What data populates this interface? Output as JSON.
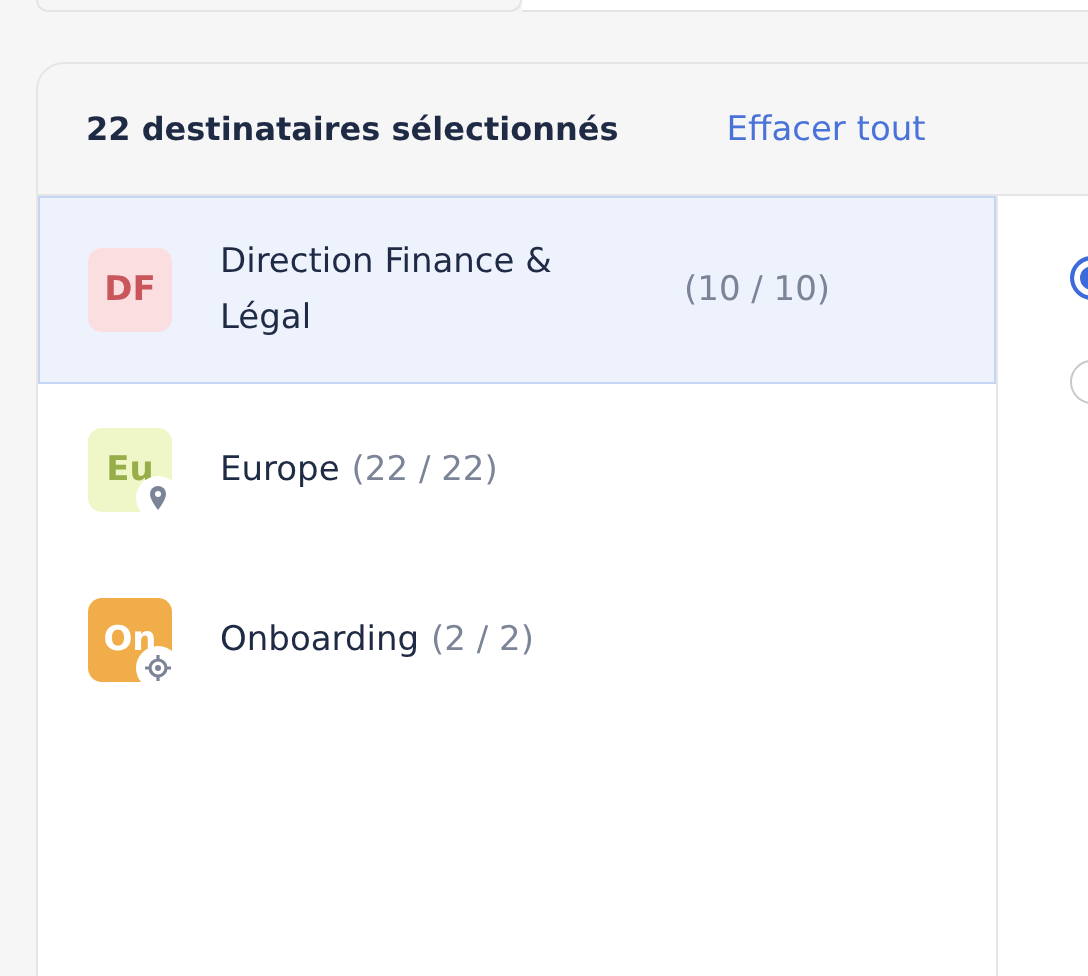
{
  "header": {
    "title": "22 destinataires sélectionnés",
    "clear_link": "Effacer tout"
  },
  "recipients": [
    {
      "initials": "DF",
      "name": "Direction Finance & Légal",
      "count": "(10 / 10)",
      "selected": true,
      "color": "#fbdfe0",
      "kind": "plain"
    },
    {
      "initials": "Eu",
      "name": "Europe",
      "count": "(22 / 22)",
      "selected": false,
      "color": "#eff7c9",
      "kind": "location"
    },
    {
      "initials": "On",
      "name": "Onboarding",
      "count": "(2 / 2)",
      "selected": false,
      "color": "#f2ad4b",
      "kind": "target"
    }
  ],
  "options": [
    {
      "selected": true
    },
    {
      "selected": false
    }
  ]
}
